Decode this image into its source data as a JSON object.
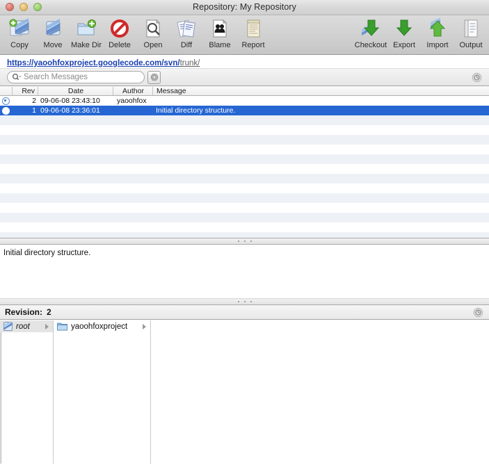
{
  "window": {
    "title": "Repository: My Repository",
    "traffic_lights": [
      "close",
      "minimize",
      "zoom"
    ]
  },
  "toolbar": {
    "left_items": [
      {
        "label": "Copy",
        "icon": "copy-svn-icon"
      },
      {
        "label": "Move",
        "icon": "move-svn-icon"
      },
      {
        "label": "Make Dir",
        "icon": "make-dir-icon"
      },
      {
        "label": "Delete",
        "icon": "delete-icon"
      },
      {
        "label": "Open",
        "icon": "open-icon"
      },
      {
        "label": "Diff",
        "icon": "diff-icon"
      },
      {
        "label": "Blame",
        "icon": "blame-icon"
      },
      {
        "label": "Report",
        "icon": "report-icon"
      }
    ],
    "right_items": [
      {
        "label": "Checkout",
        "icon": "checkout-icon"
      },
      {
        "label": "Export",
        "icon": "export-icon"
      },
      {
        "label": "Import",
        "icon": "import-icon"
      },
      {
        "label": "Output",
        "icon": "output-icon"
      }
    ]
  },
  "pathbar": {
    "url_main": "https://yaoohfoxproject.googlecode.com/svn/",
    "url_tail": "trunk/"
  },
  "search": {
    "placeholder": "Search Messages",
    "value": "",
    "gear_icon": "gear-icon",
    "status_icon": "stop-progress-icon"
  },
  "log_table": {
    "columns": [
      {
        "key": "bullet",
        "label": ""
      },
      {
        "key": "rev",
        "label": "Rev"
      },
      {
        "key": "date",
        "label": "Date"
      },
      {
        "key": "author",
        "label": "Author"
      },
      {
        "key": "msg",
        "label": "Message"
      }
    ],
    "rows": [
      {
        "bullet": "dotted",
        "rev": "2",
        "date": "09-06-08 23:43:10",
        "author": "yaoohfox",
        "msg": "",
        "selected": false
      },
      {
        "bullet": "filled",
        "rev": "1",
        "date": "09-06-08 23:36:01",
        "author": "",
        "msg": "Initial directory structure.",
        "selected": true
      }
    ],
    "empty_row_count": 14,
    "selection_color": "#2566d3",
    "stripe_color": "#eef2f7"
  },
  "message_pane": {
    "text": "Initial directory structure."
  },
  "revision_bar": {
    "label": "Revision:",
    "value": "2",
    "status_icon": "stop-progress-icon"
  },
  "browser": {
    "columns": [
      {
        "items": [
          {
            "name": "root",
            "icon": "svn-root-icon",
            "italic": true,
            "has_children": true,
            "highlighted": true
          }
        ]
      },
      {
        "items": [
          {
            "name": "yaoohfoxproject",
            "icon": "folder-icon",
            "italic": false,
            "has_children": true,
            "highlighted": false
          }
        ]
      },
      {
        "items": []
      }
    ]
  }
}
